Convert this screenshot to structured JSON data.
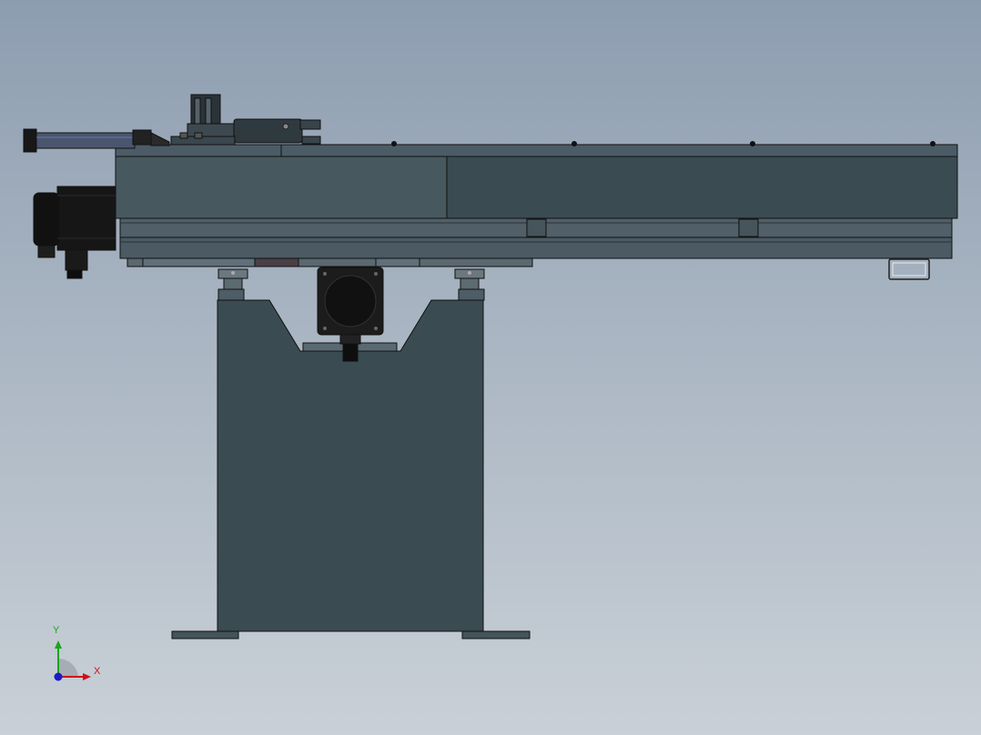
{
  "view": {
    "title": "",
    "colors": {
      "background_top": "#8d9db0",
      "background_bottom": "#c9d0d7",
      "body_dark": "#3a4b52",
      "body_light": "#47595f",
      "rail": "#4e5d66",
      "outline": "#111111",
      "motor": "#151515",
      "axis_x": "#d0101a",
      "axis_y": "#1aa51a",
      "axis_z": "#1a1ac8"
    }
  },
  "triad": {
    "x_label": "X",
    "y_label": "Y",
    "icon": "coordinate-triad-icon"
  }
}
